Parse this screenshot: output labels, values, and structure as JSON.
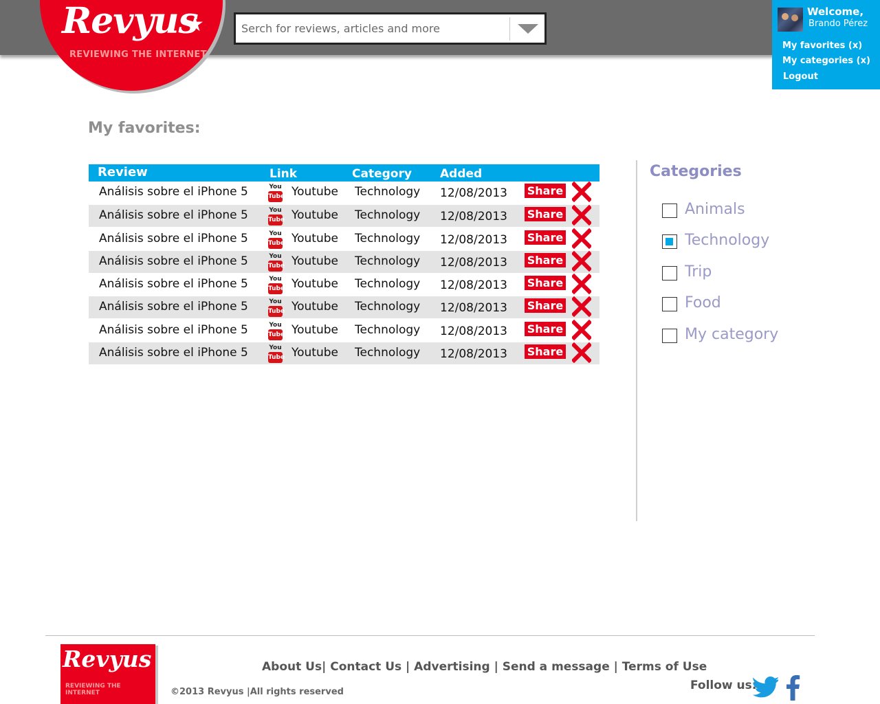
{
  "brand": {
    "logo_text": "Revyus",
    "tagline": "REVIEWING THE INTERNET"
  },
  "search": {
    "placeholder": "Serch for reviews, articles and more"
  },
  "user": {
    "welcome": "Welcome,",
    "name": "Brando Pérez",
    "links": [
      "My favorites (x)",
      "My categories (x)",
      "Logout"
    ]
  },
  "page_title": "My favorites:",
  "table": {
    "headers": [
      "Review",
      "Link",
      "Category",
      "Added"
    ],
    "rows": [
      {
        "review": "Análisis sobre el iPhone 5",
        "link": "Youtube",
        "category": "Technology",
        "added": "12/08/2013",
        "share": "Share"
      },
      {
        "review": "Análisis sobre el iPhone 5",
        "link": "Youtube",
        "category": "Technology",
        "added": "12/08/2013",
        "share": "Share"
      },
      {
        "review": "Análisis sobre el iPhone 5",
        "link": "Youtube",
        "category": "Technology",
        "added": "12/08/2013",
        "share": "Share"
      },
      {
        "review": "Análisis sobre el iPhone 5",
        "link": "Youtube",
        "category": "Technology",
        "added": "12/08/2013",
        "share": "Share"
      },
      {
        "review": "Análisis sobre el iPhone 5",
        "link": "Youtube",
        "category": "Technology",
        "added": "12/08/2013",
        "share": "Share"
      },
      {
        "review": "Análisis sobre el iPhone 5",
        "link": "Youtube",
        "category": "Technology",
        "added": "12/08/2013",
        "share": "Share"
      },
      {
        "review": "Análisis sobre el iPhone 5",
        "link": "Youtube",
        "category": "Technology",
        "added": "12/08/2013",
        "share": "Share"
      },
      {
        "review": "Análisis sobre el iPhone 5",
        "link": "Youtube",
        "category": "Technology",
        "added": "12/08/2013",
        "share": "Share"
      }
    ],
    "youtube_icon": {
      "top": "You",
      "bottom": "Tube"
    }
  },
  "categories": {
    "title": "Categories",
    "items": [
      {
        "label": "Animals",
        "checked": false
      },
      {
        "label": "Technology",
        "checked": true
      },
      {
        "label": "Trip",
        "checked": false
      },
      {
        "label": "Food",
        "checked": false
      },
      {
        "label": "My category",
        "checked": false
      }
    ]
  },
  "footer": {
    "links": [
      "About Us",
      "Contact Us",
      "Advertising",
      "Send a message",
      "Terms of Use"
    ],
    "copyright": "©2013 Revyus |All rights reserved",
    "follow": "Follow us:"
  },
  "colors": {
    "brand_red": "#e8001c",
    "accent_blue": "#00a8e8",
    "topbar_gray": "#6b6b6b",
    "category_purple": "#9a9ac8"
  }
}
